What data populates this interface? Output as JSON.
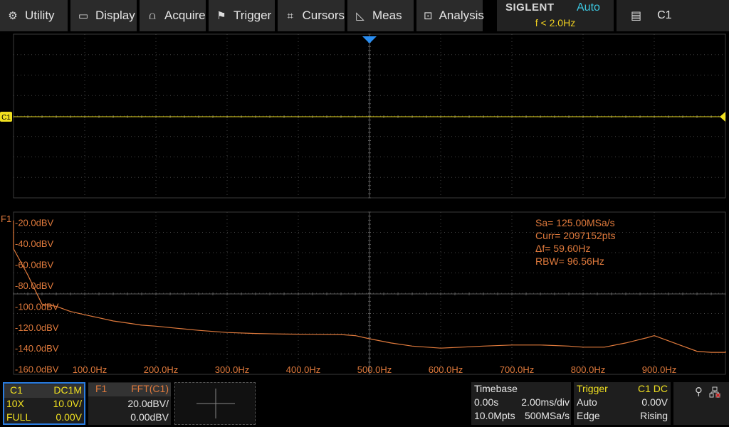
{
  "menu": {
    "utility": "Utility",
    "display": "Display",
    "acquire": "Acquire",
    "trigger": "Trigger",
    "cursors": "Cursors",
    "meas": "Meas",
    "analysis": "Analysis"
  },
  "brand": {
    "logo": "SIGLENT",
    "mode": "Auto",
    "freq": "f < 2.0Hz"
  },
  "channel_select": "C1",
  "upper_trace": {
    "marker": "C1",
    "color": "#f0e020"
  },
  "fft": {
    "marker": "F1",
    "color": "#e07a3c",
    "info": {
      "sa": "Sa=  125.00MSa/s",
      "curr": "Curr= 2097152pts",
      "df": "Δf=  59.60Hz",
      "rbw": "RBW=  96.56Hz"
    },
    "y_labels": [
      "-20.0dBV",
      "-40.0dBV",
      "-60.0dBV",
      "-80.0dBV",
      "-100.0dBV",
      "-120.0dBV",
      "-140.0dBV",
      "-160.0dBV"
    ],
    "x_labels": [
      "100.0Hz",
      "200.0Hz",
      "300.0Hz",
      "400.0Hz",
      "500.0Hz",
      "600.0Hz",
      "700.0Hz",
      "800.0Hz",
      "900.0Hz"
    ],
    "trace": {
      "freq_hz": [
        -20,
        0,
        20,
        40,
        60,
        80,
        100,
        120,
        140,
        160,
        180,
        200,
        230,
        260,
        300,
        340,
        380,
        420,
        460,
        480,
        500,
        530,
        560,
        600,
        630,
        660,
        700,
        740,
        780,
        800,
        830,
        860,
        890,
        900,
        920,
        940,
        960,
        980,
        1000,
        1020
      ],
      "dbv": [
        -18,
        -45,
        -70,
        -98,
        -100,
        -105,
        -108,
        -111,
        -114,
        -116,
        -118,
        -119,
        -121,
        -123,
        -125,
        -126,
        -126.5,
        -126.8,
        -127,
        -128,
        -131,
        -135,
        -138,
        -140,
        -139,
        -138,
        -137,
        -137,
        -138,
        -139,
        -139,
        -135,
        -130,
        -128,
        -133,
        -138,
        -143,
        -144,
        -144,
        -143
      ]
    }
  },
  "status": {
    "c1": {
      "name": "C1",
      "coupling": "DC1M",
      "probe": "10X",
      "scale": "10.0V/",
      "bw": "FULL",
      "offset": "0.00V"
    },
    "f1": {
      "name": "F1",
      "func": "FFT(C1)",
      "scale": "20.0dBV/",
      "offset": "0.00dBV"
    },
    "timebase": {
      "title": "Timebase",
      "delay": "0.00s",
      "scale": "2.00ms/div",
      "mem": "10.0Mpts",
      "rate": "500MSa/s"
    },
    "trigger": {
      "title": "Trigger",
      "source": "C1 DC",
      "mode": "Auto",
      "level": "0.00V",
      "type": "Edge",
      "slope": "Rising"
    }
  }
}
